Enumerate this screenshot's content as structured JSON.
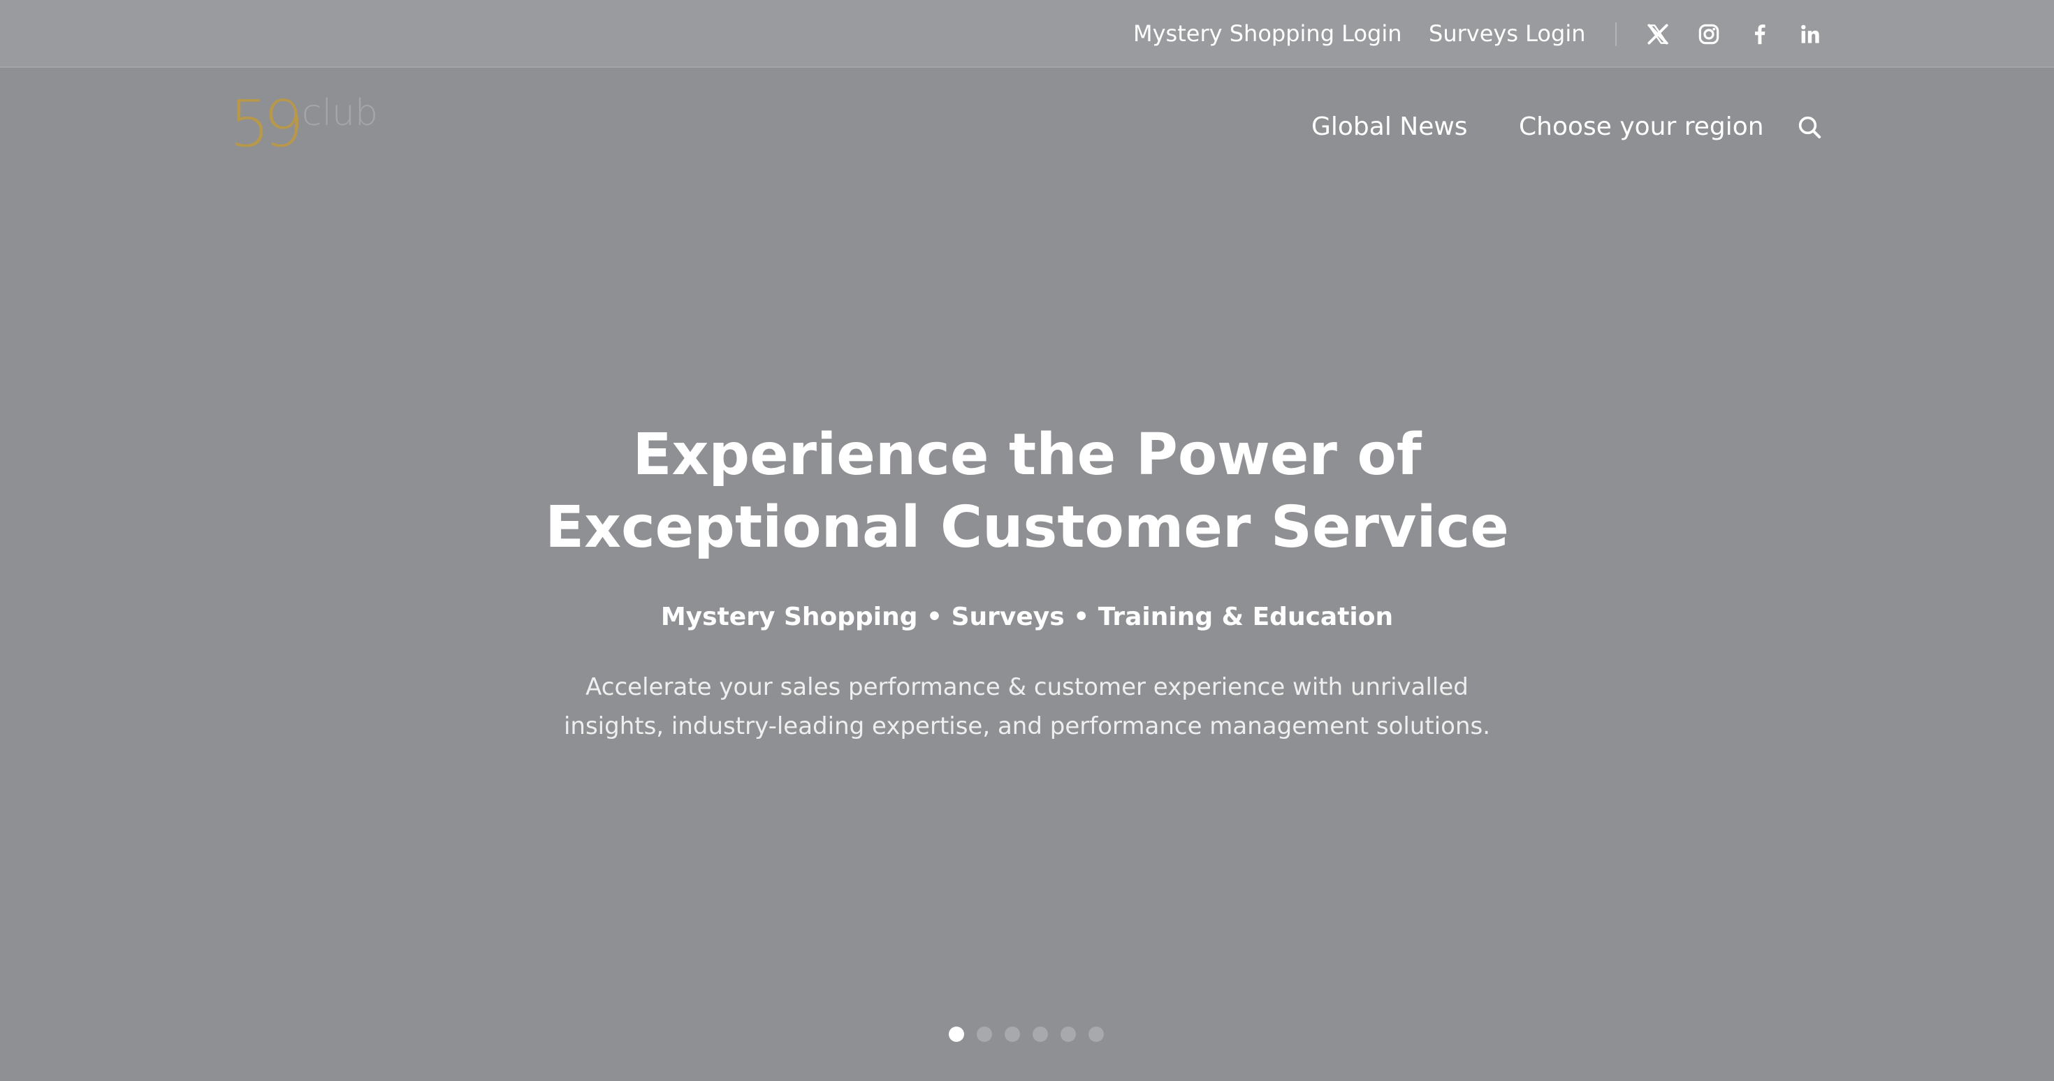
{
  "topbar": {
    "links": [
      {
        "label": "Mystery Shopping Login"
      },
      {
        "label": "Surveys Login"
      }
    ],
    "social": [
      {
        "icon": "x-twitter-icon"
      },
      {
        "icon": "instagram-icon"
      },
      {
        "icon": "facebook-icon"
      },
      {
        "icon": "linkedin-icon"
      }
    ]
  },
  "header": {
    "logo": {
      "number": "59",
      "text": "club"
    },
    "nav": [
      {
        "label": "Global News"
      },
      {
        "label": "Choose your region"
      }
    ],
    "search_icon": "search-icon"
  },
  "hero": {
    "title_lines": [
      "Experience the Power of",
      "Exceptional Customer Service"
    ],
    "subtitle": "Mystery Shopping • Surveys • Training & Education",
    "description_lines": [
      "Accelerate your sales performance & customer experience with unrivalled",
      "insights, industry-leading expertise, and performance management solutions."
    ]
  },
  "carousel": {
    "slide_count": 6,
    "active_index": 0
  },
  "colors": {
    "background": "#8f9093",
    "topbar": "#9a9b9e",
    "logo_accent": "#b8984a",
    "text": "#ffffff"
  }
}
